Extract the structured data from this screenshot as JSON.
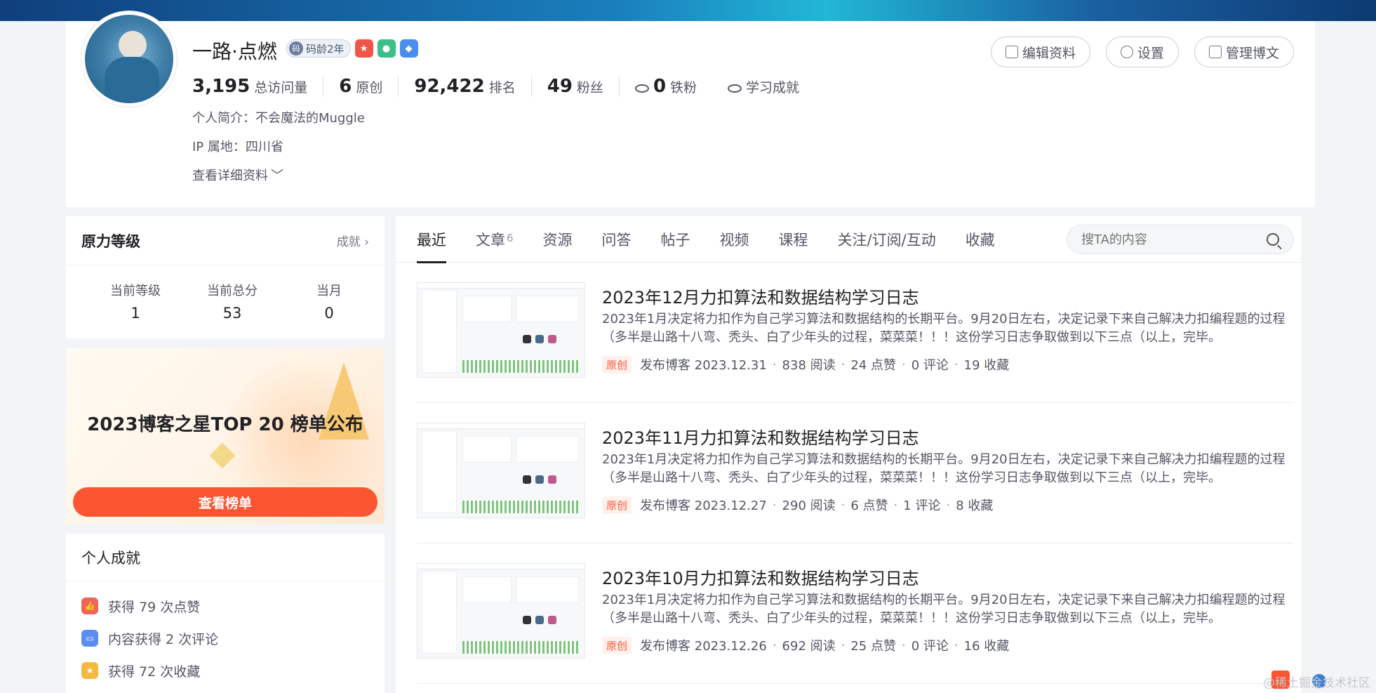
{
  "profile": {
    "name": "一路·点燃",
    "code_age_badge": "码龄2年",
    "stats": [
      {
        "value": "3,195",
        "label": "总访问量"
      },
      {
        "value": "6",
        "label": "原创"
      },
      {
        "value": "92,422",
        "label": "排名"
      },
      {
        "value": "49",
        "label": "粉丝"
      },
      {
        "value": "0",
        "label": "铁粉"
      }
    ],
    "learning_label": "学习成就",
    "intro": "个人简介：不会魔法的Muggle",
    "ip": "IP 属地：四川省",
    "more": "查看详细资料",
    "buttons": {
      "edit": "编辑资料",
      "settings": "设置",
      "manage": "管理博文"
    }
  },
  "level": {
    "title": "原力等级",
    "link": "成就",
    "cols": [
      {
        "label": "当前等级",
        "value": "1"
      },
      {
        "label": "当前总分",
        "value": "53"
      },
      {
        "label": "当月",
        "value": "0"
      }
    ]
  },
  "banner": {
    "title": "2023博客之星TOP 20 榜单公布",
    "cta": "查看榜单"
  },
  "achievements": {
    "title": "个人成就",
    "items": [
      {
        "text": "获得 79 次点赞",
        "color": "#f0655a"
      },
      {
        "text": "内容获得 2 次评论",
        "color": "#5a8ef0"
      },
      {
        "text": "获得 72 次收藏",
        "color": "#f5b940"
      }
    ]
  },
  "tabs": [
    {
      "label": "最近",
      "count": ""
    },
    {
      "label": "文章",
      "count": "6"
    },
    {
      "label": "资源",
      "count": ""
    },
    {
      "label": "问答",
      "count": ""
    },
    {
      "label": "帖子",
      "count": ""
    },
    {
      "label": "视频",
      "count": ""
    },
    {
      "label": "课程",
      "count": ""
    },
    {
      "label": "关注/订阅/互动",
      "count": ""
    },
    {
      "label": "收藏",
      "count": ""
    }
  ],
  "search": {
    "placeholder": "搜TA的内容"
  },
  "articles": [
    {
      "title": "2023年12月力扣算法和数据结构学习日志",
      "desc": "2023年1月决定将力扣作为自己学习算法和数据结构的长期平台。9月20日左右，决定记录下来自己解决力扣编程题的过程（多半是山路十八弯、秃头、白了少年头的过程，菜菜菜！！！这份学习日志争取做到以下三点（以上，完毕。",
      "tag": "原创",
      "date": "发布博客 2023.12.31",
      "reads": "838 阅读",
      "likes": "24 点赞",
      "comments": "0 评论",
      "favs": "19 收藏"
    },
    {
      "title": "2023年11月力扣算法和数据结构学习日志",
      "desc": "2023年1月决定将力扣作为自己学习算法和数据结构的长期平台。9月20日左右，决定记录下来自己解决力扣编程题的过程（多半是山路十八弯、秃头、白了少年头的过程，菜菜菜！！！这份学习日志争取做到以下三点（以上，完毕。",
      "tag": "原创",
      "date": "发布博客 2023.12.27",
      "reads": "290 阅读",
      "likes": "6 点赞",
      "comments": "1 评论",
      "favs": "8 收藏"
    },
    {
      "title": "2023年10月力扣算法和数据结构学习日志",
      "desc": "2023年1月决定将力扣作为自己学习算法和数据结构的长期平台。9月20日左右，决定记录下来自己解决力扣编程题的过程（多半是山路十八弯、秃头、白了少年头的过程，菜菜菜！！！这份学习日志争取做到以下三点（以上，完毕。",
      "tag": "原创",
      "date": "发布博客 2023.12.26",
      "reads": "692 阅读",
      "likes": "25 点赞",
      "comments": "0 评论",
      "favs": "16 收藏"
    }
  ],
  "watermark": "@稀土掘金技术社区",
  "colors": {
    "accent": "#fc5531",
    "text": "#222226",
    "muted": "#555666"
  }
}
